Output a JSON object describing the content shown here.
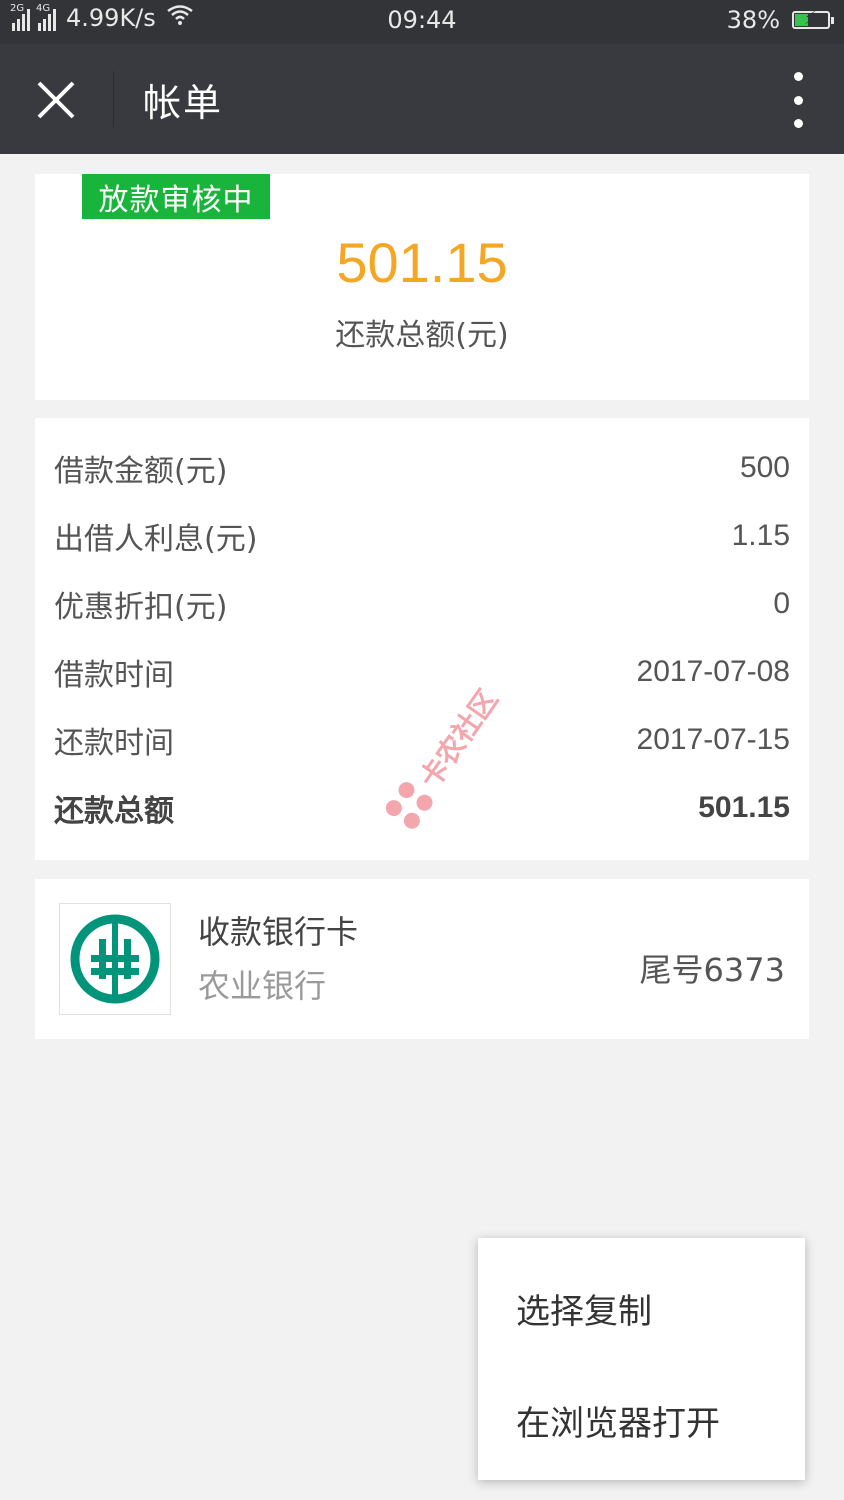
{
  "status_bar": {
    "network_1": "2G",
    "network_2": "4G",
    "speed": "4.99K/s",
    "time": "09:44",
    "battery_percent": "38%",
    "battery_level": 0.38
  },
  "header": {
    "title": "帐单"
  },
  "summary": {
    "status_badge": "放款审核中",
    "amount": "501.15",
    "amount_label": "还款总额(元)"
  },
  "details": {
    "rows": [
      {
        "label": "借款金额(元)",
        "value": "500"
      },
      {
        "label": "出借人利息(元)",
        "value": "1.15"
      },
      {
        "label": "优惠折扣(元)",
        "value": "0"
      },
      {
        "label": "借款时间",
        "value": "2017-07-08"
      },
      {
        "label": "还款时间",
        "value": "2017-07-15"
      },
      {
        "label": "还款总额",
        "value": "501.15"
      }
    ]
  },
  "watermark": {
    "text": "卡农社区"
  },
  "bank_card": {
    "title": "收款银行卡",
    "bank_name": "农业银行",
    "tail_number": "尾号6373",
    "logo_color": "#00957a"
  },
  "popup_menu": {
    "items": [
      "选择复制",
      "在浏览器打开"
    ]
  },
  "colors": {
    "badge_green": "#19b43c",
    "amount_orange": "#f5a623",
    "titlebar": "#393a3f"
  }
}
